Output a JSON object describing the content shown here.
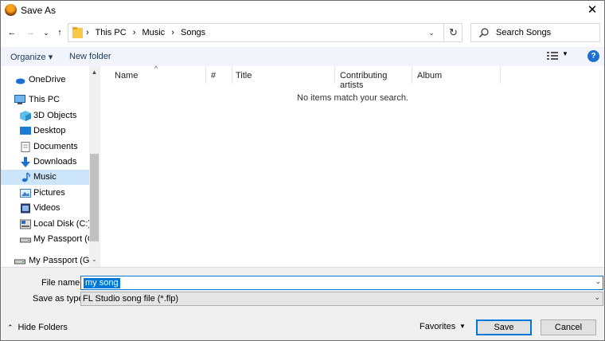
{
  "window": {
    "title": "Save As",
    "close_glyph": "✕"
  },
  "navigation": {
    "back_glyph": "←",
    "forward_glyph": "→",
    "recent_glyph": "⌄",
    "up_glyph": "↑",
    "breadcrumb": [
      "This PC",
      "Music",
      "Songs"
    ],
    "separator": "›",
    "refresh_glyph": "↻",
    "search_placeholder": "Search Songs"
  },
  "command_bar": {
    "organize_label": "Organize ▾",
    "new_folder_label": "New folder",
    "help_glyph": "?",
    "view_drop_glyph": "▼"
  },
  "nav_pane": {
    "items": [
      {
        "label": "OneDrive",
        "icon": "cloud-icon"
      },
      {
        "label": "This PC",
        "icon": "computer-icon"
      },
      {
        "label": "3D Objects",
        "icon": "cube-icon"
      },
      {
        "label": "Desktop",
        "icon": "desktop-icon"
      },
      {
        "label": "Documents",
        "icon": "documents-icon"
      },
      {
        "label": "Downloads",
        "icon": "download-arrow-icon"
      },
      {
        "label": "Music",
        "icon": "music-note-icon",
        "selected": true
      },
      {
        "label": "Pictures",
        "icon": "pictures-icon"
      },
      {
        "label": "Videos",
        "icon": "videos-icon"
      },
      {
        "label": "Local Disk (C:)",
        "icon": "disk-icon"
      },
      {
        "label": "My Passport (G:)",
        "icon": "drive-icon"
      },
      {
        "label": "My Passport (G:)",
        "icon": "drive-icon"
      }
    ],
    "scroll_up_glyph": "▲",
    "scroll_down_glyph": "⌄"
  },
  "file_list": {
    "columns": [
      "Name",
      "#",
      "Title",
      "Contributing artists",
      "Album"
    ],
    "sort_glyph": "^",
    "empty_message": "No items match your search."
  },
  "bottom": {
    "file_name_label": "File name:",
    "file_name_value": "my song",
    "save_type_label": "Save as type:",
    "save_type_value": "FL Studio song file (*.flp)",
    "dropdown_glyph": "⌄",
    "hide_folders_label": "Hide Folders",
    "hide_folders_glyph": "⌃",
    "favorites_label": "Favorites",
    "favorites_glyph": "▼",
    "save_label": "Save",
    "cancel_label": "Cancel"
  },
  "colors": {
    "accent": "#0078d7",
    "selection": "#cce4f7",
    "command_bar": "#f1f5fb",
    "folder": "#f7c948"
  }
}
